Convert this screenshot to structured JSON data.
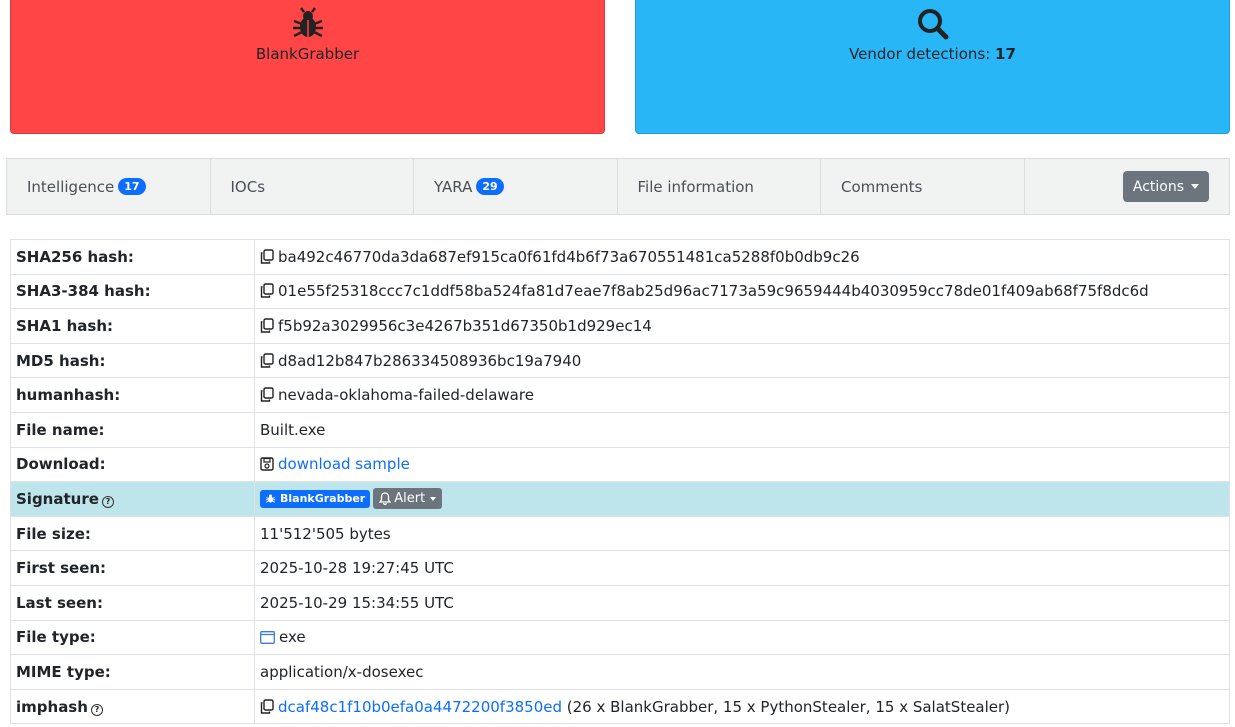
{
  "cards": {
    "signature": {
      "label": "BlankGrabber",
      "icon": "bug-icon",
      "color": "#ff4545"
    },
    "vendor": {
      "prefix": "Vendor detections: ",
      "count": "17",
      "icon": "search-icon",
      "color": "#29b6f6"
    }
  },
  "tabs": [
    {
      "label": "Intelligence",
      "badge": "17"
    },
    {
      "label": "IOCs"
    },
    {
      "label": "YARA",
      "badge": "29"
    },
    {
      "label": "File information"
    },
    {
      "label": "Comments"
    }
  ],
  "actions_label": "Actions",
  "rows": {
    "sha256": {
      "key": "SHA256 hash:",
      "value": "ba492c46770da3da687ef915ca0f61fd4b6f73a670551481ca5288f0b0db9c26"
    },
    "sha3": {
      "key": "SHA3-384 hash:",
      "value": "01e55f25318ccc7c1ddf58ba524fa81d7eae7f8ab25d96ac7173a59c9659444b4030959cc78de01f409ab68f75f8dc6d"
    },
    "sha1": {
      "key": "SHA1 hash:",
      "value": "f5b92a3029956c3e4267b351d67350b1d929ec14"
    },
    "md5": {
      "key": "MD5 hash:",
      "value": "d8ad12b847b286334508936bc19a7940"
    },
    "humanhash": {
      "key": "humanhash:",
      "value": "nevada-oklahoma-failed-delaware"
    },
    "filename": {
      "key": "File name:",
      "value": "Built.exe"
    },
    "download": {
      "key": "Download:",
      "value": "download sample"
    },
    "signature": {
      "key": "Signature",
      "badge": "BlankGrabber",
      "alert": "Alert"
    },
    "filesize": {
      "key": "File size:",
      "value": "11'512'505 bytes"
    },
    "firstseen": {
      "key": "First seen:",
      "value": "2025-10-28 19:27:45 UTC"
    },
    "lastseen": {
      "key": "Last seen:",
      "value": "2025-10-29 15:34:55 UTC"
    },
    "filetype": {
      "key": "File type:",
      "value": "exe"
    },
    "mime": {
      "key": "MIME type:",
      "value": "application/x-dosexec"
    },
    "imphash": {
      "key": "imphash",
      "value": "dcaf48c1f10b0efa0a4472200f3850ed",
      "suffix": " (26 x BlankGrabber, 15 x PythonStealer, 15 x SalatStealer)"
    }
  }
}
